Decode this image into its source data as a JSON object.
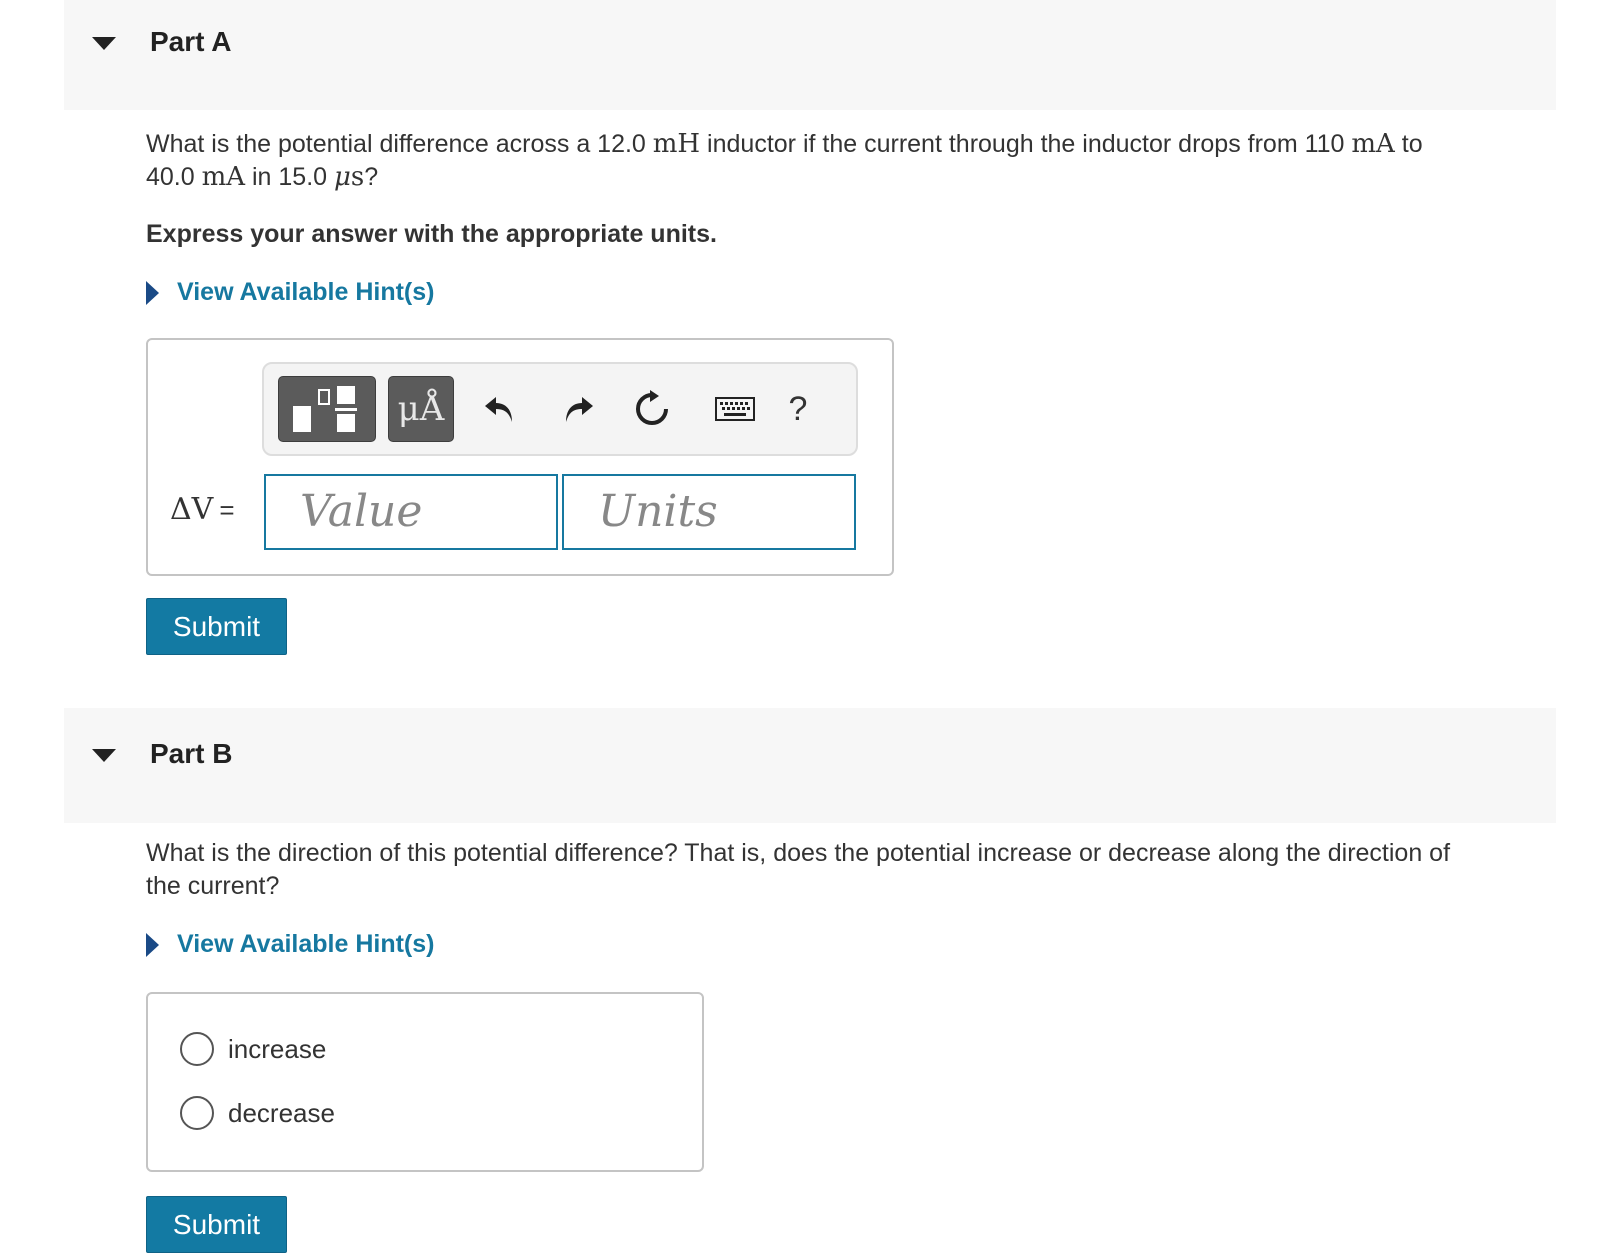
{
  "partA": {
    "title": "Part A",
    "question": {
      "t1": "What is the potential difference across a 12.0 ",
      "u1": "mH",
      "t2": " inductor if the current through the inductor drops from 110 ",
      "u2": "mA",
      "t3": " to",
      "t4": "40.0 ",
      "u3": "mA",
      "t5": " in 15.0 ",
      "u4a": "μ",
      "u4b": "s",
      "t6": "?"
    },
    "instruction": "Express your answer with the appropriate units.",
    "hint_label": "View Available Hint(s)",
    "toolbar": {
      "units_label": "μÅ",
      "help_label": "?"
    },
    "variable_label": "ΔV",
    "equals": "=",
    "value_placeholder": "Value",
    "units_placeholder": "Units",
    "submit_label": "Submit"
  },
  "partB": {
    "title": "Part B",
    "question_line1": "What is the direction of this potential difference? That is, does the potential increase or decrease along the direction of",
    "question_line2": "the current?",
    "hint_label": "View Available Hint(s)",
    "choices": [
      "increase",
      "decrease"
    ],
    "submit_label": "Submit"
  },
  "colors": {
    "accent": "#137aa3",
    "link": "#1678a0",
    "header_bg": "#f7f7f7"
  },
  "icons": [
    "caret-down-icon",
    "caret-right-icon",
    "templates-icon",
    "undo-icon",
    "redo-icon",
    "reset-icon",
    "keyboard-icon"
  ]
}
